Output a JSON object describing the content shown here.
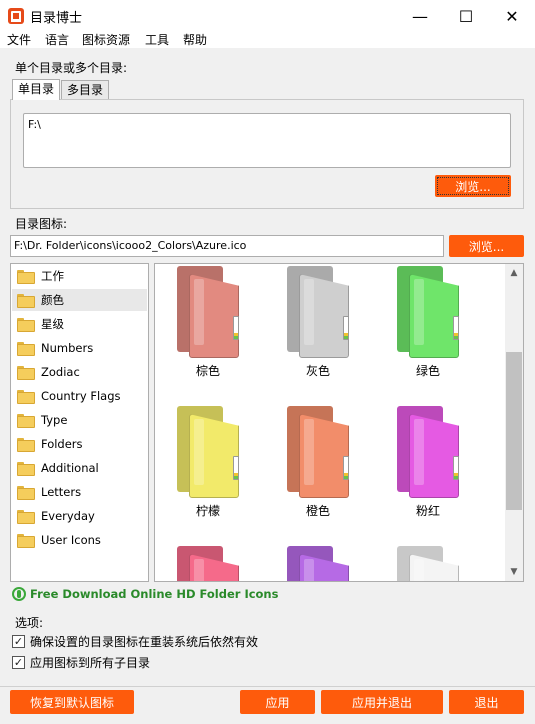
{
  "window": {
    "title": "目录博士",
    "minimize": "—",
    "maximize": "☐",
    "close": "✕"
  },
  "menu": [
    "文件",
    "语言",
    "图标资源",
    "工具",
    "帮助"
  ],
  "dir_section": {
    "label": "单个目录或多个目录:",
    "tabs": [
      "单目录",
      "多目录"
    ],
    "path": "F:\\",
    "browse_label": "浏览..."
  },
  "icon_section": {
    "label": "目录图标:",
    "path": "F:\\Dr. Folder\\icons\\icooo2_Colors\\Azure.ico",
    "browse_label": "浏览..."
  },
  "categories": [
    "工作",
    "颜色",
    "星级",
    "Numbers",
    "Zodiac",
    "Country Flags",
    "Type",
    "Folders",
    "Additional",
    "Letters",
    "Everyday",
    "User Icons"
  ],
  "selected_category": "颜色",
  "folders": [
    {
      "name": "棕色",
      "color": "#e28a80"
    },
    {
      "name": "灰色",
      "color": "#cfcfcf"
    },
    {
      "name": "绿色",
      "color": "#6fe56a"
    },
    {
      "name": "柠檬",
      "color": "#f2ea6a"
    },
    {
      "name": "橙色",
      "color": "#f28d6a"
    },
    {
      "name": "粉红",
      "color": "#e55ae3"
    },
    {
      "name": "",
      "color": "#f56a8a"
    },
    {
      "name": "",
      "color": "#b66ae5"
    },
    {
      "name": "",
      "color": "#f4f4f4"
    }
  ],
  "download_link": "Free Download Online HD Folder Icons",
  "options": {
    "label": "选项:",
    "items": [
      {
        "label": "确保设置的目录图标在重装系统后依然有效",
        "checked": true
      },
      {
        "label": "应用图标到所有子目录",
        "checked": true
      }
    ],
    "check_glyph": "✓"
  },
  "buttons": {
    "restore": "恢复到默认图标",
    "apply": "应用",
    "apply_exit": "应用并退出",
    "exit": "退出"
  },
  "scroll": {
    "up": "▲",
    "down": "▼"
  }
}
